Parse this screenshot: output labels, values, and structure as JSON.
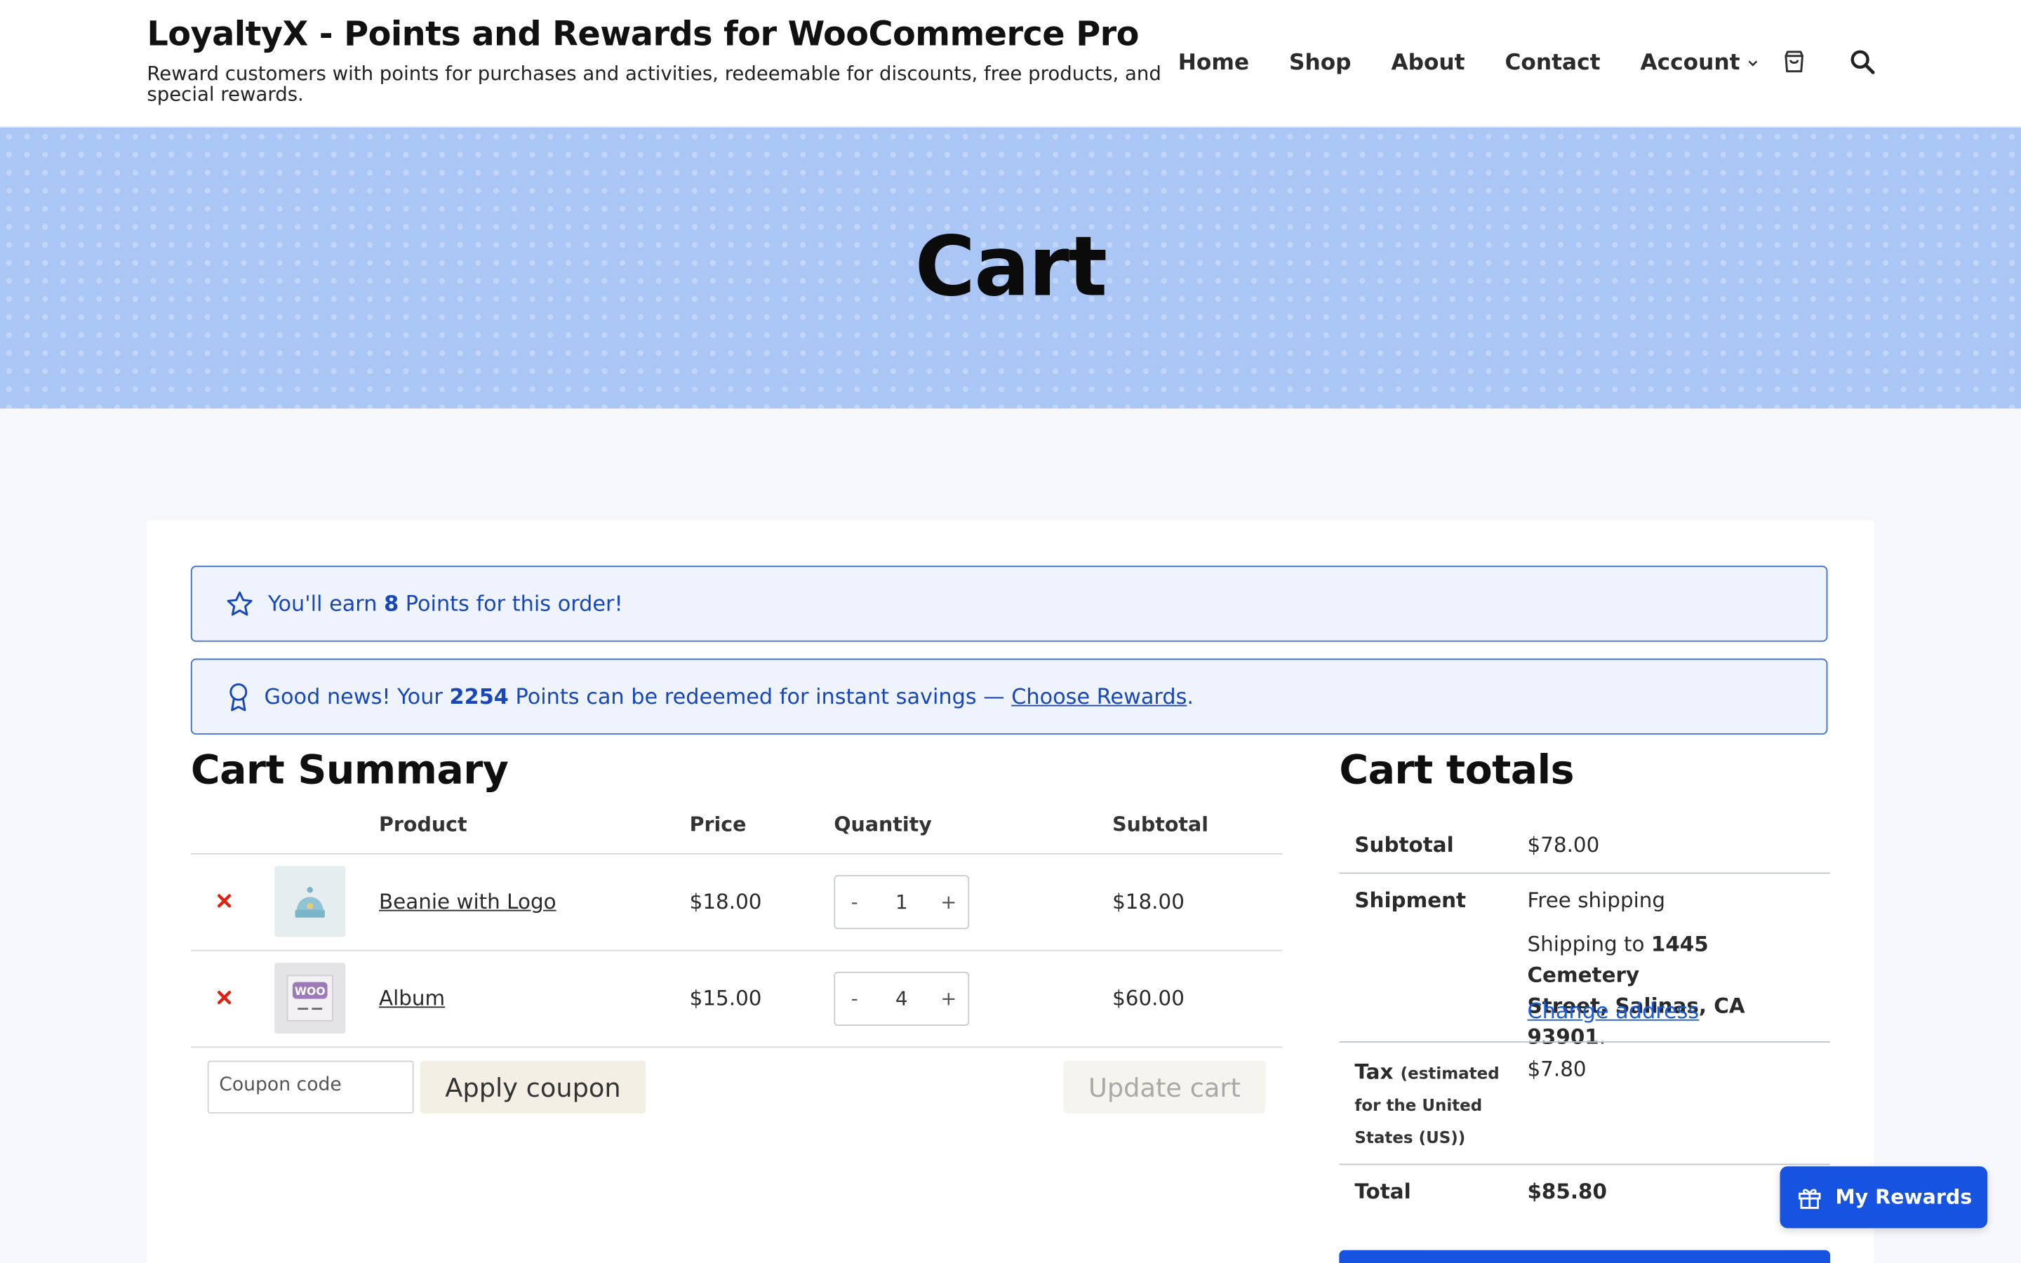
{
  "header": {
    "site_title": "LoyaltyX - Points and Rewards for WooCommerce Pro",
    "tagline": "Reward customers with points for purchases and activities, redeemable for discounts, free products, and special rewards.",
    "nav": [
      "Home",
      "Shop",
      "About",
      "Contact",
      "Account"
    ],
    "icons": [
      "cart-icon",
      "search-icon"
    ]
  },
  "hero": {
    "title": "Cart"
  },
  "notices": {
    "earn": {
      "pre": "You'll earn ",
      "points": "8",
      "post": " Points for this order!"
    },
    "redeem": {
      "pre": "Good news! Your ",
      "points": "2254",
      "mid": " Points can be redeemed for instant savings — ",
      "link": "Choose Rewards",
      "post": "."
    }
  },
  "cart": {
    "heading": "Cart Summary",
    "columns": [
      "Product",
      "Price",
      "Quantity",
      "Subtotal"
    ],
    "items": [
      {
        "name": "Beanie with Logo",
        "price": "$18.00",
        "quantity": "1",
        "subtotal": "$18.00",
        "thumb": "beanie"
      },
      {
        "name": "Album",
        "price": "$15.00",
        "quantity": "4",
        "subtotal": "$60.00",
        "thumb": "album"
      }
    ],
    "coupon_placeholder": "Coupon code",
    "apply_coupon": "Apply coupon",
    "update_cart": "Update cart"
  },
  "totals": {
    "heading": "Cart totals",
    "subtotal_label": "Subtotal",
    "subtotal": "$78.00",
    "shipment_label": "Shipment",
    "shipping_method": "Free shipping",
    "shipping_to_pre": "Shipping to ",
    "shipping_address_line1": "1445 Cemetery",
    "shipping_address_line2": "Street, Salinas, CA 93901",
    "shipping_to_post": ".",
    "change_address": "Change address",
    "tax_label": "Tax",
    "tax_note_1": "(estimated",
    "tax_note_2": "for the United",
    "tax_note_3": "States (US))",
    "tax": "$7.80",
    "total_label": "Total",
    "total": "$85.80"
  },
  "rewards_button": "My Rewards",
  "colors": {
    "accent": "#1653e0",
    "notice_border": "#3a6fd8",
    "notice_bg": "#eef3fd",
    "hero_bg": "#a9c6f5",
    "remove": "#dd2211"
  }
}
